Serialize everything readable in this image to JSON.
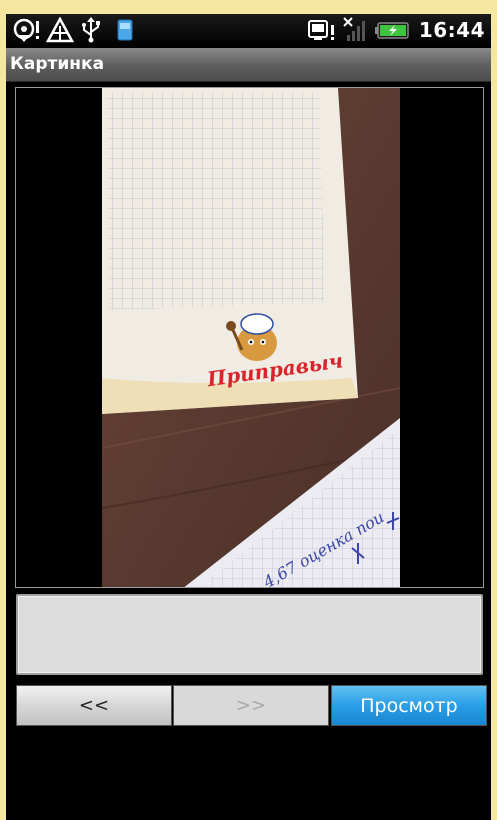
{
  "status_bar": {
    "time": "16:44",
    "icons_left": [
      "location-alert-icon",
      "warning-icon",
      "usb-icon",
      "sd-card-icon"
    ],
    "icons_right": [
      "sync-alert-icon",
      "no-signal-icon",
      "battery-charging-icon"
    ]
  },
  "window": {
    "title": "Картинка"
  },
  "photo": {
    "logo_text": "Приправыч",
    "note_text": "4,67 оценка пои"
  },
  "text_field": {
    "value": ""
  },
  "buttons": {
    "prev_label": "<<",
    "next_label": ">>",
    "view_label": "Просмотр"
  },
  "colors": {
    "accent": "#2a9ee6",
    "frame_background": "#f5e6a0",
    "title_bar": "#5e5e5e"
  }
}
